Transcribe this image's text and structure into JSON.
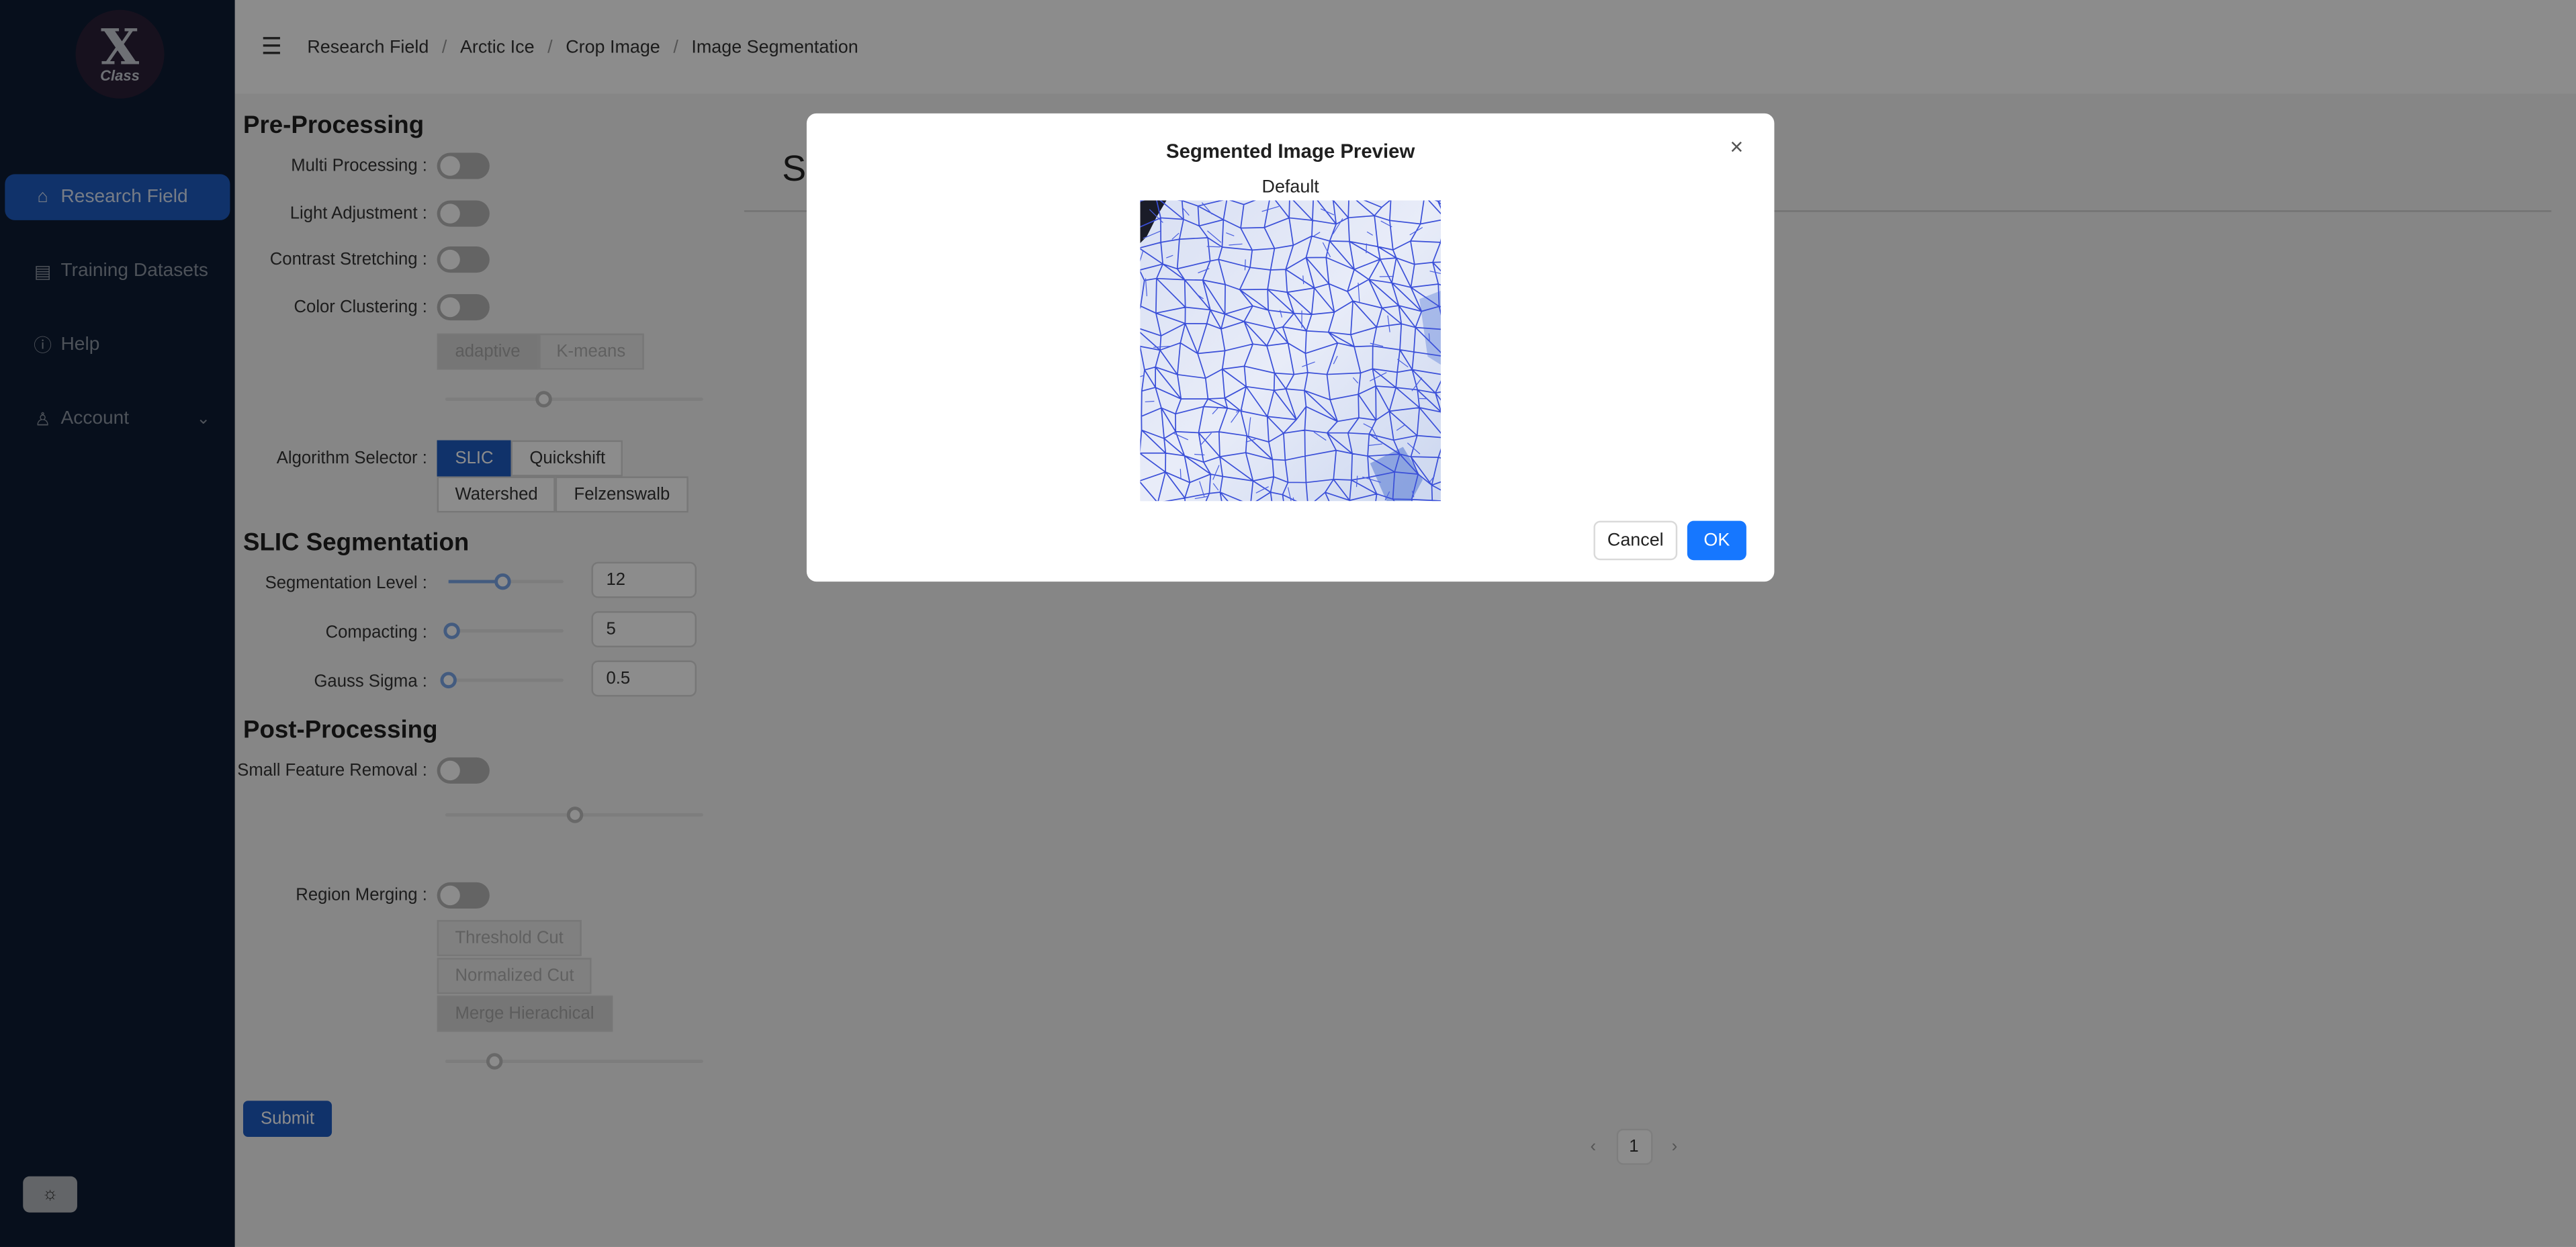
{
  "sidebar": {
    "logo": {
      "mark": "X",
      "text": "Class"
    },
    "items": [
      {
        "label": "Research Field",
        "icon": "home-icon",
        "active": true
      },
      {
        "label": "Training Datasets",
        "icon": "document-icon",
        "active": false
      },
      {
        "label": "Help",
        "icon": "help-icon",
        "active": false
      },
      {
        "label": "Account",
        "icon": "user-icon",
        "active": false
      }
    ],
    "theme_icon": "sun-icon"
  },
  "header": {
    "breadcrumb": [
      "Research Field",
      "Arctic Ice",
      "Crop Image",
      "Image Segmentation"
    ],
    "separator": "/"
  },
  "pre_processing": {
    "title": "Pre-Processing",
    "multi_processing": "Multi Processing",
    "light_adjustment": "Light Adjustment",
    "contrast_stretching": "Contrast Stretching",
    "color_clustering": "Color Clustering",
    "clustering_options": [
      "adaptive",
      "K-means"
    ],
    "clustering_level": 0.38,
    "algorithm_selector": "Algorithm Selector",
    "algorithms": [
      "SLIC",
      "Quickshift",
      "Watershed",
      "Felzenswalb"
    ],
    "selected_algorithm": "SLIC"
  },
  "slic": {
    "title": "SLIC Segmentation",
    "segmentation_level_label": "Segmentation Level",
    "segmentation_level": "12",
    "compacting_label": "Compacting",
    "compacting": "5",
    "gauss_sigma_label": "Gauss Sigma",
    "gauss_sigma": "0.5"
  },
  "post_processing": {
    "title": "Post-Processing",
    "small_feature_removal": "Small Feature Removal",
    "region_merging": "Region Merging",
    "merge_options": [
      "Threshold Cut",
      "Normalized Cut",
      "Merge Hierachical"
    ],
    "submit": "Submit"
  },
  "main": {
    "title_fragment": "Se",
    "pagination": {
      "prev": "‹",
      "page": "1",
      "next": "›"
    }
  },
  "modal": {
    "title": "Segmented Image Preview",
    "subtitle": "Default",
    "close": "×",
    "cancel": "Cancel",
    "ok": "OK"
  },
  "colors": {
    "sidebar_bg": "#0e1c33",
    "accent": "#1e5bc2",
    "ok_button": "#1677ff",
    "segmentation_lines": "#3a4fd8"
  }
}
